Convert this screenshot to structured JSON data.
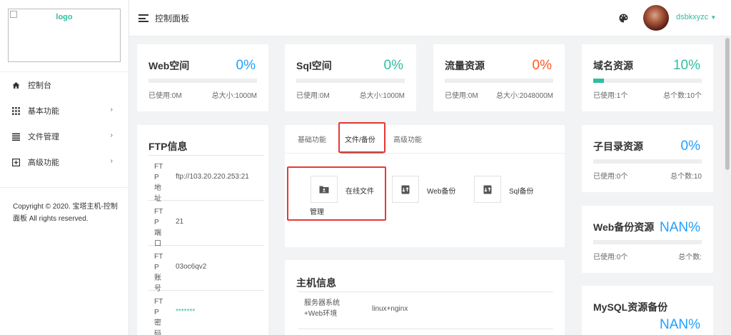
{
  "logo": {
    "alt": "logo"
  },
  "sidebar": {
    "items": [
      {
        "label": "控制台",
        "icon": "home-icon"
      },
      {
        "label": "基本功能",
        "icon": "grid-icon"
      },
      {
        "label": "文件管理",
        "icon": "list-icon"
      },
      {
        "label": "高级功能",
        "icon": "plus-square-icon"
      }
    ],
    "copyright": "Copyright © 2020. 宝塔主机-控制面板 All rights reserved."
  },
  "header": {
    "title": "控制面板",
    "username": "dsbkxyzc"
  },
  "stats": [
    {
      "title": "Web空间",
      "percent": "0%",
      "used": "已使用:0M",
      "total": "总大小:1000M",
      "color": "#1e9fff",
      "fill": 0
    },
    {
      "title": "Sql空间",
      "percent": "0%",
      "used": "已使用:0M",
      "total": "总大小:1000M",
      "color": "#2fbfa0",
      "fill": 0
    },
    {
      "title": "流量资源",
      "percent": "0%",
      "used": "已使用:0M",
      "total": "总大小:2048000M",
      "color": "#ff5722",
      "fill": 0
    },
    {
      "title": "域名资源",
      "percent": "10%",
      "used": "已使用:1个",
      "total": "总个数:10个",
      "color": "#2fbfa0",
      "fill": 0.1
    }
  ],
  "side_stats": [
    {
      "title": "子目录资源",
      "percent": "0%",
      "used": "已使用:0个",
      "total": "总个数:10"
    },
    {
      "title": "Web备份资源",
      "percent": "NAN%",
      "used": "已使用:0个",
      "total": "总个数:"
    },
    {
      "title": "MySQL资源备份",
      "percent": "NAN%"
    }
  ],
  "ftp": {
    "title": "FTP信息",
    "rows": [
      {
        "key": "FTP地址",
        "value": "ftp://103.20.220.253:21"
      },
      {
        "key": "FTP端口",
        "value": "21"
      },
      {
        "key": "FTP账号",
        "value": "03oc6qv2"
      },
      {
        "key": "FTP密码",
        "value": "*******"
      }
    ]
  },
  "tabs": [
    {
      "label": "基础功能"
    },
    {
      "label": "文件/备份"
    },
    {
      "label": "高级功能"
    }
  ],
  "tools": [
    {
      "label_line1": "在线文件",
      "label_line2": "管理"
    },
    {
      "label": "Web备份"
    },
    {
      "label": "Sql备份"
    }
  ],
  "host": {
    "title": "主机信息",
    "rows": [
      {
        "key_line1": "服务器系统",
        "key_line2": "+Web环境",
        "value": "linux+nginx"
      }
    ]
  },
  "accent_color": "#2fbfa0"
}
